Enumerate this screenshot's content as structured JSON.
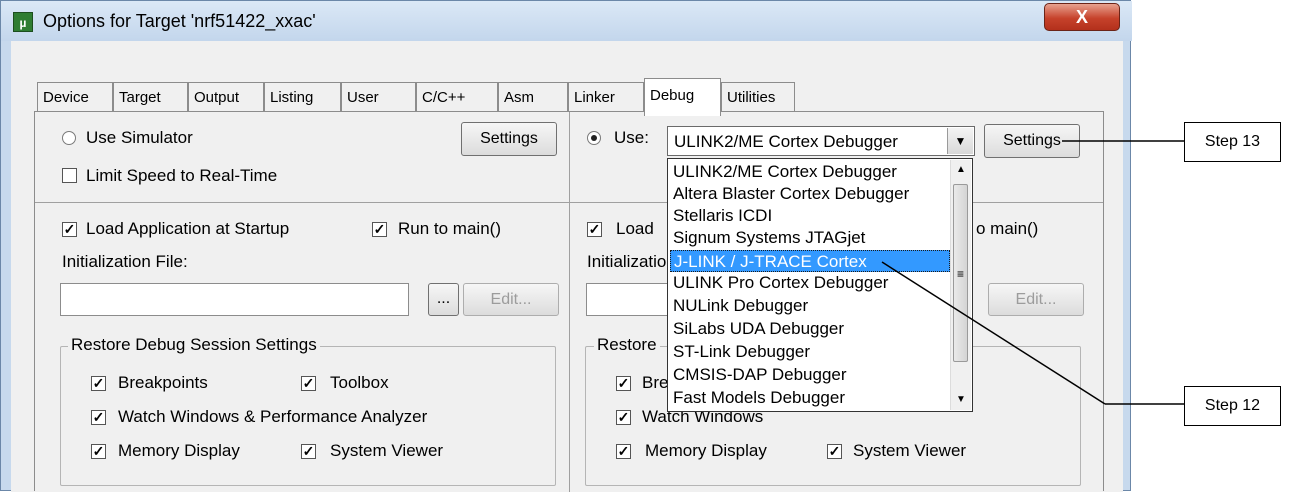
{
  "window": {
    "title": "Options for Target 'nrf51422_xxac'",
    "close_label": "X"
  },
  "tabs": [
    "Device",
    "Target",
    "Output",
    "Listing",
    "User",
    "C/C++",
    "Asm",
    "Linker",
    "Debug",
    "Utilities"
  ],
  "active_tab": "Debug",
  "left": {
    "use_simulator_label": "Use Simulator",
    "settings_label": "Settings",
    "limit_speed_label": "Limit Speed to Real-Time",
    "load_app_label": "Load Application at Startup",
    "run_to_main_label": "Run to main()",
    "init_file_label": "Initialization File:",
    "browse_label": "...",
    "edit_label": "Edit...",
    "restore_group_label": "Restore Debug Session Settings",
    "breakpoints_label": "Breakpoints",
    "toolbox_label": "Toolbox",
    "watch_label": "Watch Windows & Performance Analyzer",
    "memory_label": "Memory Display",
    "system_viewer_label": "System Viewer"
  },
  "right": {
    "use_label": "Use:",
    "selected_debugger": "ULINK2/ME Cortex Debugger",
    "settings_label": "Settings",
    "load_partial": "Load",
    "run_partial": "o main()",
    "init_partial": "Initializatio",
    "edit_label": "Edit...",
    "restore_partial": "Restore",
    "breakpoints_partial": "Bre",
    "watch_label": "Watch Windows",
    "memory_label": "Memory Display",
    "system_viewer_label": "System Viewer",
    "debugger_options": [
      "ULINK2/ME Cortex Debugger",
      "Altera Blaster Cortex Debugger",
      "Stellaris ICDI",
      "Signum Systems JTAGjet",
      "J-LINK / J-TRACE Cortex",
      "ULINK Pro Cortex Debugger",
      "NULink Debugger",
      "SiLabs UDA Debugger",
      "ST-Link Debugger",
      "CMSIS-DAP Debugger",
      "Fast Models Debugger"
    ],
    "highlighted_option": "J-LINK / J-TRACE Cortex"
  },
  "callouts": {
    "step13": "Step 13",
    "step12": "Step 12"
  },
  "colors": {
    "selection": "#3399ff",
    "window_frame": "#c7d9ed",
    "close_button": "#c6422b"
  }
}
